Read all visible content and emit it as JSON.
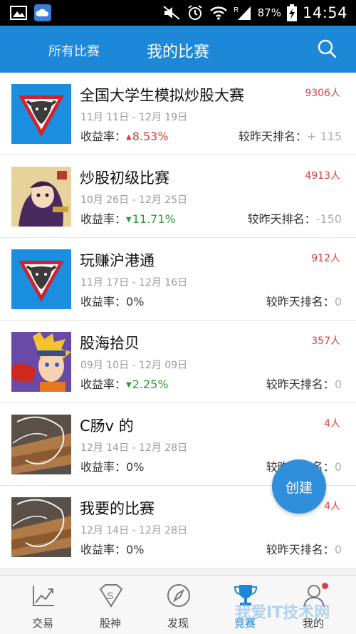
{
  "status_bar": {
    "battery_pct": "87%",
    "time": "14:54",
    "icons": [
      "gallery-icon",
      "cloud-app-icon",
      "mute-icon",
      "alarm-icon",
      "wifi-icon",
      "signal-icon",
      "battery-charging-icon"
    ]
  },
  "header": {
    "tab_all": "所有比赛",
    "tab_mine": "我的比赛",
    "search_icon": "search-icon",
    "color": "#1e88d8"
  },
  "labels": {
    "yield": "收益率：",
    "rank": "较昨天排名："
  },
  "competitions": [
    {
      "title": "全国大学生模拟炒股大赛",
      "participants": "9306人",
      "dates": "11月 11日 - 12月 19日",
      "yield": "8.53%",
      "trend": "up",
      "rank_change": "+ 115",
      "thumb": "bull-logo"
    },
    {
      "title": "炒股初级比赛",
      "participants": "4913人",
      "dates": "10月 26日 - 12月 25日",
      "yield": "11.71%",
      "trend": "down",
      "rank_change": "-150",
      "thumb": "anime-warrior"
    },
    {
      "title": "玩赚沪港通",
      "participants": "912人",
      "dates": "11月 17日 - 12月 16日",
      "yield": "0%",
      "trend": "flat",
      "rank_change": "0",
      "thumb": "bull-logo"
    },
    {
      "title": "股海拾贝",
      "participants": "357人",
      "dates": "09月 10日 - 12月 09日",
      "yield": "2.25%",
      "trend": "down",
      "rank_change": "0",
      "thumb": "anime-ninja"
    },
    {
      "title": "C肠v 的",
      "participants": "4人",
      "dates": "12月 14日 - 12月 28日",
      "yield": "0%",
      "trend": "flat",
      "rank_change": "0",
      "thumb": "wood-photo"
    },
    {
      "title": "我要的比赛",
      "participants": "4人",
      "dates": "12月 14日 - 12月 28日",
      "yield": "0%",
      "trend": "flat",
      "rank_change": "0",
      "thumb": "wood-photo"
    }
  ],
  "fab": {
    "label": "创建"
  },
  "bottom_nav": [
    {
      "label": "交易",
      "icon": "trade-chart-icon"
    },
    {
      "label": "股神",
      "icon": "superman-s-icon"
    },
    {
      "label": "发现",
      "icon": "compass-icon"
    },
    {
      "label": "竞赛",
      "icon": "trophy-icon",
      "active": true
    },
    {
      "label": "我的",
      "icon": "user-icon",
      "badge": true
    }
  ],
  "watermark": "我爱IT技术网",
  "colors": {
    "up": "#e03c3c",
    "down": "#2a9a3a",
    "accent": "#1e88d8"
  }
}
